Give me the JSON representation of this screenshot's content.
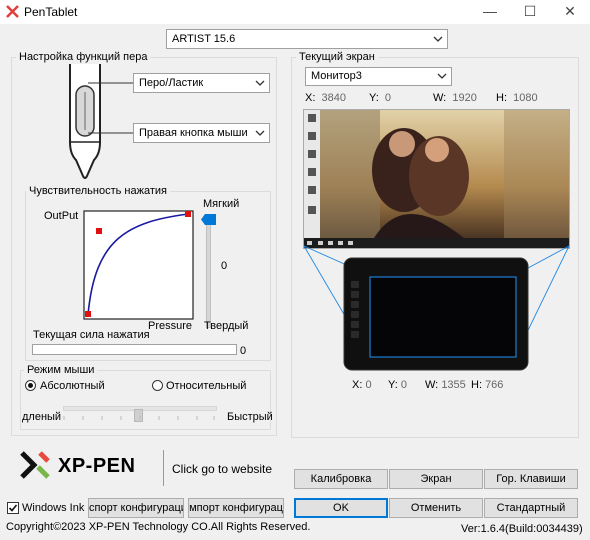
{
  "window": {
    "title": "PenTablet",
    "minimize_symbol": "—",
    "maximize_symbol": "☐",
    "close_symbol": "✕"
  },
  "device": {
    "selected": "ARTIST 15.6"
  },
  "pen_settings": {
    "title": "Настройка функций пера",
    "upper_button": "Перо/Ластик",
    "lower_button": "Правая кнопка мыши"
  },
  "pressure": {
    "title": "Чувствительность нажатия",
    "output_label": "OutPut",
    "pressure_label": "Pressure",
    "soft_label": "Мягкий",
    "hard_label": "Твердый",
    "slider_value": "0",
    "current_label": "Текущая сила нажатия",
    "current_value": "0",
    "current_fraction": 0
  },
  "mouse_mode": {
    "title": "Режим мыши",
    "absolute_label": "Абсолютный",
    "relative_label": "Относительный",
    "selected": "absolute",
    "slow_label": "дленый",
    "fast_label": "Быстрый",
    "speed_fraction": 0.5
  },
  "screen": {
    "title": "Текущий экран",
    "monitor": "Монитор3",
    "x_label": "X:",
    "x_value": "3840",
    "y_label": "Y:",
    "y_value": "0",
    "w_label": "W:",
    "w_value": "1920",
    "h_label": "H:",
    "h_value": "1080"
  },
  "tablet_area": {
    "x_label": "X:",
    "x_value": "0",
    "y_label": "Y:",
    "y_value": "0",
    "w_label": "W:",
    "w_value": "1355",
    "h_label": "H:",
    "h_value": "766"
  },
  "brand": {
    "logo_text": "XP-PEN",
    "website_link": "Click go to website"
  },
  "buttons": {
    "calibration": "Калибровка",
    "screen": "Экран",
    "hotkeys": "Гор. Клавиши",
    "export": "спорт конфигураци",
    "import": "мпорт  конфигурац",
    "ok": "OK",
    "cancel": "Отменить",
    "default": "Стандартный"
  },
  "windows_ink": {
    "label": "Windows Ink",
    "checked": true
  },
  "footer": {
    "copyright": "Copyright©2023  XP-PEN Technology CO.All Rights Reserved.",
    "version": "Ver:1.6.4(Build:0034439)"
  },
  "colors": {
    "accent": "#0078d7",
    "curve": "#1a1aa0",
    "point": "#e01010",
    "slider": "#0078d7"
  }
}
